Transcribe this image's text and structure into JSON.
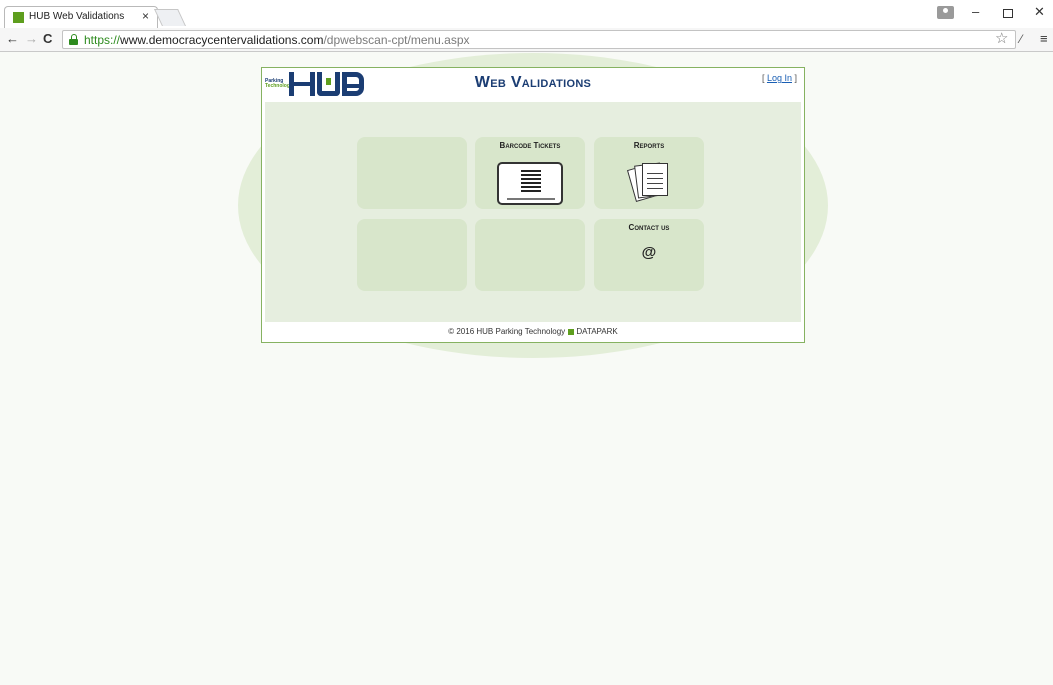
{
  "browser": {
    "tab_title": "HUB Web Validations",
    "tab_close": "×",
    "url_secure_part": "https://",
    "url_host": "www.democracycentervalidations.com",
    "url_path": "/dpwebscan-cpt/menu.aspx",
    "icons": [
      "back-arrow",
      "forward-arrow",
      "reload",
      "lock",
      "star",
      "extension",
      "menu"
    ]
  },
  "header": {
    "logo_small_line1": "Parking",
    "logo_small_line2": "Technology",
    "title": "Web Validations",
    "login_open": "[ ",
    "login_link": "Log In",
    "login_close": " ]"
  },
  "tiles": [
    {
      "label": "",
      "icon": ""
    },
    {
      "label": "Barcode Tickets",
      "icon": "barcode-ticket"
    },
    {
      "label": "Reports",
      "icon": "documents"
    },
    {
      "label": "",
      "icon": ""
    },
    {
      "label": "",
      "icon": ""
    },
    {
      "label": "Contact us",
      "icon": "@"
    }
  ],
  "footer": {
    "copyright": "© 2016 HUB Parking Technology",
    "brand": "DATAPARK"
  },
  "colors": {
    "brand_navy": "#1b3d73",
    "brand_green": "#5e9e1e",
    "panel_bg": "#e6eedf",
    "tile_bg": "#d8e6cb"
  }
}
